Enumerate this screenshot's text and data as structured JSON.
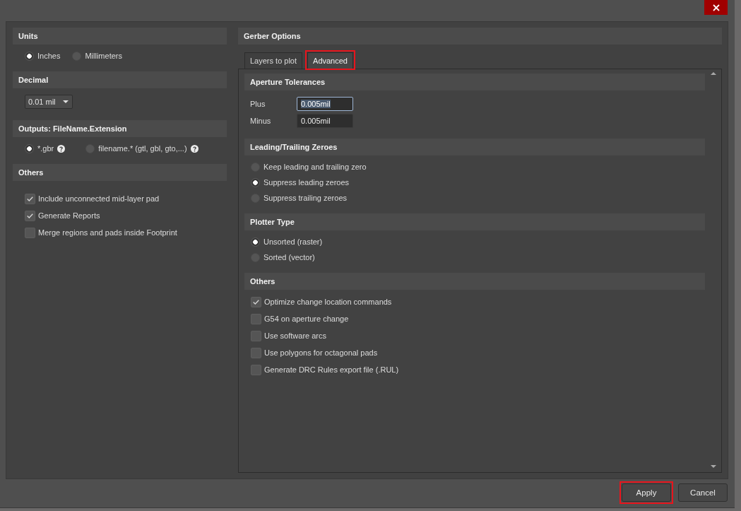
{
  "output_settings": {
    "sections": [
      {
        "kind": "radios",
        "title": "Units",
        "options": [
          {
            "label": "Inches",
            "selected": true
          },
          {
            "label": "Millimeters",
            "selected": false
          }
        ]
      },
      {
        "kind": "dropdown",
        "title": "Decimal",
        "value": "0.01 mil"
      },
      {
        "kind": "radios",
        "title": "Outputs: FileName.Extension",
        "options": [
          {
            "label": "*.gbr",
            "selected": true,
            "help": true
          },
          {
            "label": "filename.* (gtl, gbl, gto,...)",
            "selected": false,
            "help": true
          }
        ]
      },
      {
        "kind": "checks",
        "title": "Others",
        "options": [
          {
            "label": "Include unconnected mid-layer pad",
            "checked": true
          },
          {
            "label": "Generate Reports",
            "checked": true
          },
          {
            "label": "Merge regions and pads inside Footprint",
            "checked": false
          }
        ]
      }
    ]
  },
  "gerber_options": {
    "title": "Gerber Options",
    "tabs": [
      {
        "label": "Layers to plot",
        "selected": false,
        "highlighted": false
      },
      {
        "label": "Advanced",
        "selected": true,
        "highlighted": true
      }
    ],
    "sections": [
      {
        "kind": "fields",
        "title": "Aperture Tolerances",
        "fields": [
          {
            "label": "Plus",
            "value": "0.005mil",
            "focused": true
          },
          {
            "label": "Minus",
            "value": "0.005mil",
            "focused": false
          }
        ]
      },
      {
        "kind": "radios",
        "title": "Leading/Trailing Zeroes",
        "options": [
          {
            "label": "Keep leading and trailing zero",
            "selected": false
          },
          {
            "label": "Suppress leading zeroes",
            "selected": true
          },
          {
            "label": "Suppress trailing zeroes",
            "selected": false
          }
        ]
      },
      {
        "kind": "radios",
        "title": "Plotter Type",
        "options": [
          {
            "label": "Unsorted (raster)",
            "selected": true
          },
          {
            "label": "Sorted (vector)",
            "selected": false
          }
        ]
      },
      {
        "kind": "checks",
        "title": "Others",
        "options": [
          {
            "label": "Optimize change location commands",
            "checked": true
          },
          {
            "label": "G54 on aperture change",
            "checked": false
          },
          {
            "label": "Use software arcs",
            "checked": false
          },
          {
            "label": "Use polygons for octagonal pads",
            "checked": false
          },
          {
            "label": "Generate DRC Rules export file (.RUL)",
            "checked": false
          }
        ]
      }
    ]
  },
  "buttons": [
    {
      "label": "Apply",
      "highlighted": true
    },
    {
      "label": "Cancel",
      "highlighted": false
    }
  ]
}
